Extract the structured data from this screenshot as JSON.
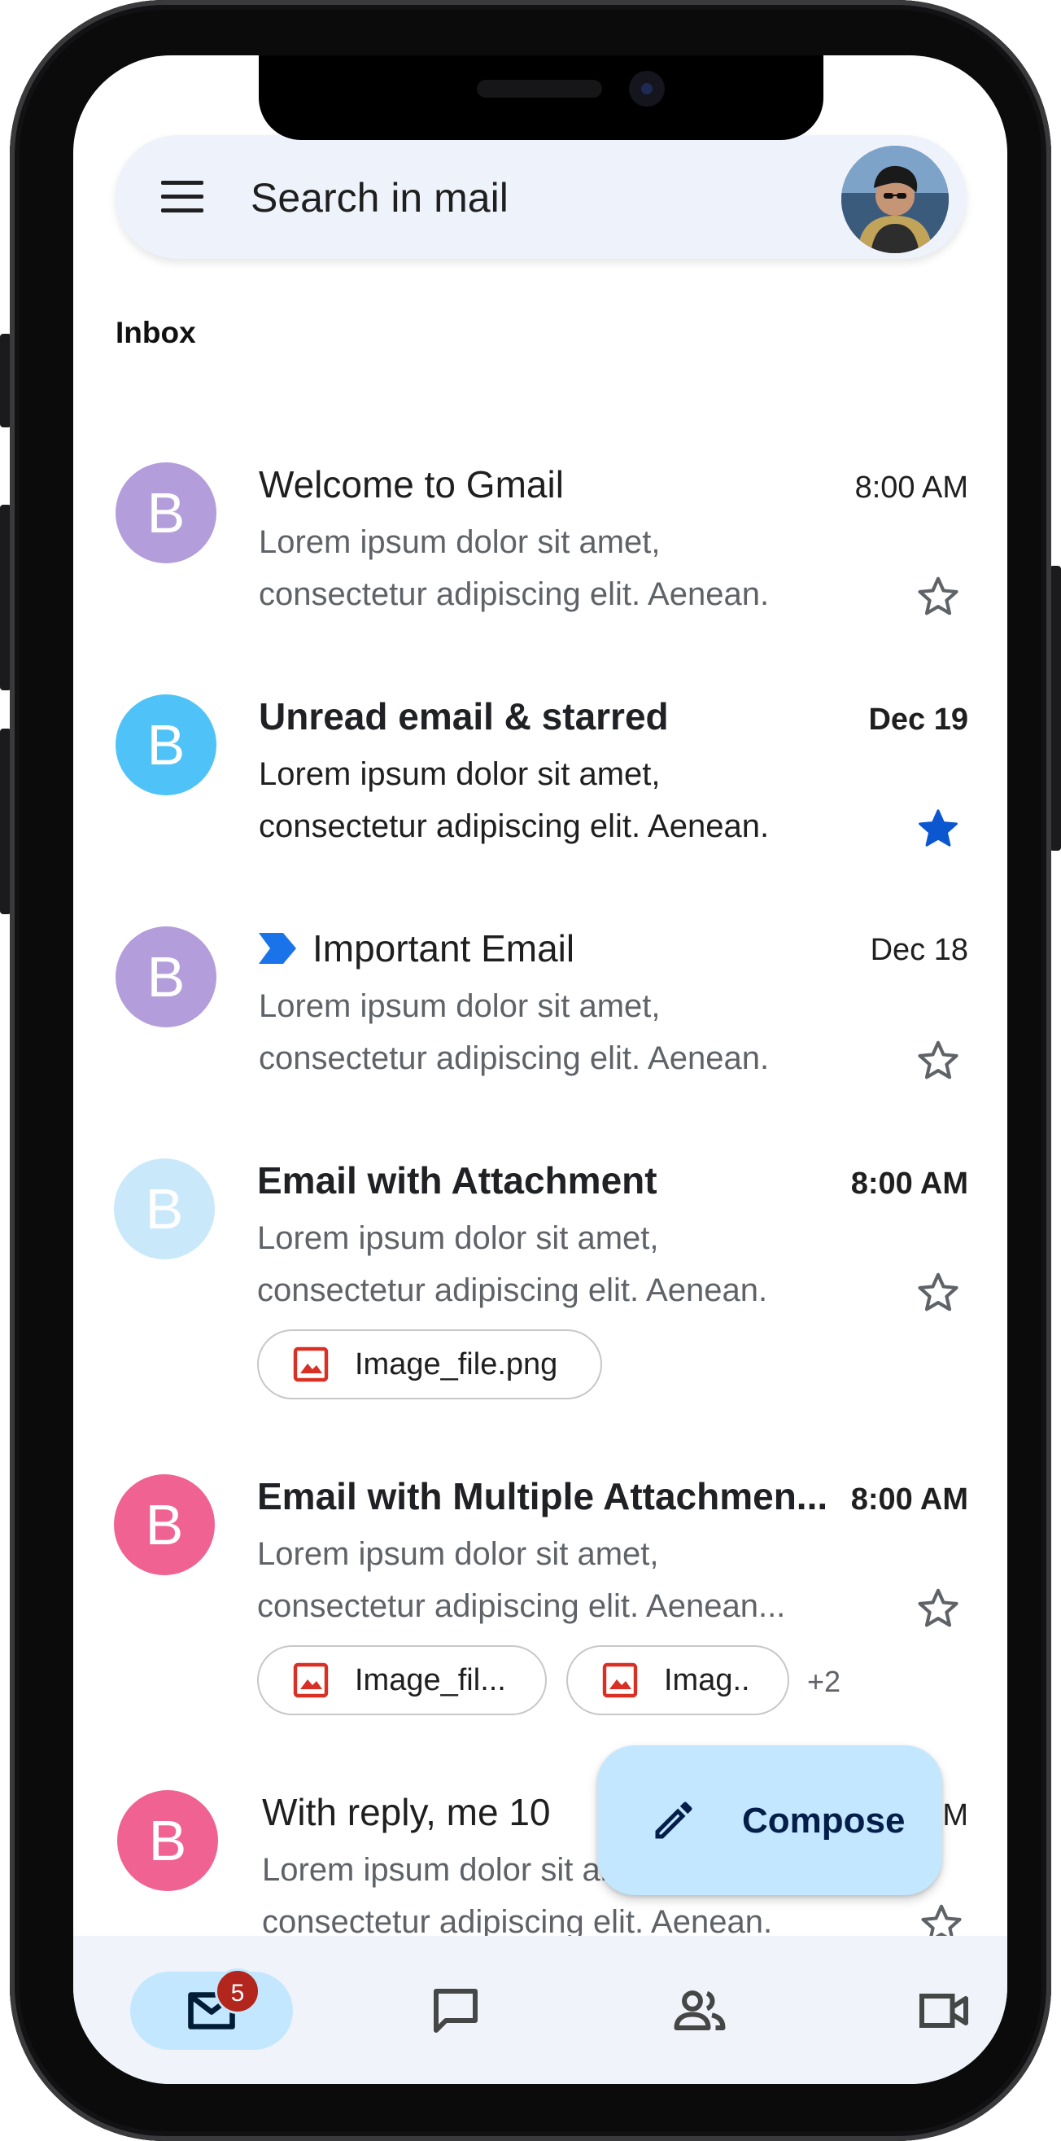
{
  "search": {
    "placeholder": "Search in mail"
  },
  "inbox": {
    "label": "Inbox",
    "emails": [
      {
        "avatar_letter": "B",
        "avatar_color": "#B39DDB",
        "subject": "Welcome to Gmail",
        "time": "8:00 AM",
        "snippet_line1": "Lorem ipsum dolor sit amet,",
        "snippet_line2": "consectetur adipiscing elit. Aenean.",
        "unread": false,
        "starred": false
      },
      {
        "avatar_letter": "B",
        "avatar_color": "#4FC3F7",
        "subject": "Unread email & starred",
        "time": "Dec 19",
        "snippet_line1": "Lorem ipsum dolor sit amet,",
        "snippet_line2": "consectetur adipiscing elit. Aenean.",
        "unread": true,
        "starred": true
      },
      {
        "avatar_letter": "B",
        "avatar_color": "#B39DDB",
        "subject": "Important Email",
        "time": "Dec 18",
        "snippet_line1": "Lorem ipsum dolor sit amet,",
        "snippet_line2": "consectetur adipiscing elit. Aenean.",
        "unread": false,
        "starred": false,
        "important": true
      },
      {
        "avatar_letter": "B",
        "avatar_color": "#C9E9FB",
        "subject": "Email with Attachment",
        "time": "8:00 AM",
        "snippet_line1": "Lorem ipsum dolor sit amet,",
        "snippet_line2": "consectetur adipiscing elit. Aenean.",
        "unread": true,
        "starred": false,
        "attachments": [
          "Image_file.png"
        ]
      },
      {
        "avatar_letter": "B",
        "avatar_color": "#F06292",
        "subject": "Email with Multiple Attachmen...",
        "time": "8:00 AM",
        "snippet_line1": "Lorem ipsum dolor sit amet,",
        "snippet_line2": "consectetur adipiscing elit. Aenean...",
        "unread": true,
        "starred": false,
        "attachments": [
          "Image_fil...",
          "Imag.."
        ],
        "more_attachments": "+2"
      },
      {
        "avatar_letter": "B",
        "avatar_color": "#F06292",
        "subject": "With reply, me 10",
        "time": "8:00 AM",
        "snippet_line1": "Lorem ipsum dolor sit amet,",
        "snippet_line2": "consectetur adipiscing elit. Aenean.",
        "unread": false,
        "starred": false
      }
    ]
  },
  "fab": {
    "label": "Compose"
  },
  "bottom_nav": {
    "items": [
      {
        "icon": "mail-icon",
        "active": true,
        "badge": "5"
      },
      {
        "icon": "chat-icon",
        "active": false
      },
      {
        "icon": "spaces-icon",
        "active": false
      },
      {
        "icon": "meet-icon",
        "active": false
      }
    ]
  },
  "colors": {
    "accent": "#0B57D0",
    "fab": "#C2E7FF",
    "nav_bg": "#F0F4FA",
    "search_bg": "#EEF2FA",
    "badge": "#B3261E",
    "attachment_icon": "#D93025"
  }
}
